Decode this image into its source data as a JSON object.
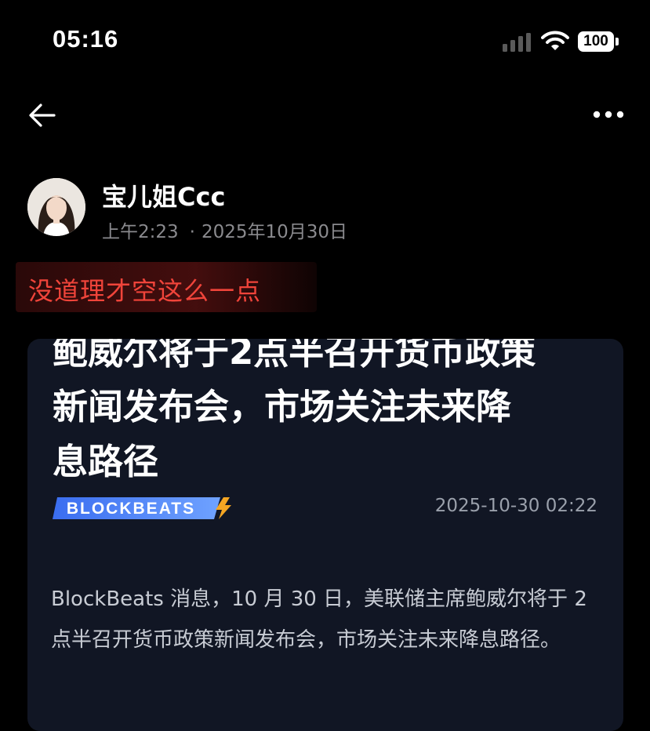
{
  "status_bar": {
    "time": "05:16",
    "battery": "100",
    "icons": [
      "signal-icon",
      "wifi-icon",
      "battery-icon"
    ]
  },
  "nav": {
    "icons": [
      "back-arrow-icon",
      "more-icon"
    ]
  },
  "post": {
    "author": "宝儿姐Ccc",
    "time": "上午2:23",
    "date": "2025年10月30日",
    "separator": "·",
    "text": "没道理才空这么一点"
  },
  "card": {
    "title_lines": [
      "鲍威尔将于2点半召开货币政策",
      "新闻发布会，市场关注未来降",
      "息路径"
    ],
    "source": "BLOCKBEATS",
    "datetime": "2025-10-30 02:22",
    "body": "BlockBeats 消息，10 月 30 日，美联储主席鲍威尔将于 2 点半召开货币政策新闻发布会，市场关注未来降息路径。",
    "colors": {
      "background": "#111624",
      "logo_gradient_start": "#3a6df0",
      "logo_gradient_end": "#6fa2ff",
      "bolt": "#f5a623"
    }
  },
  "colors": {
    "highlight_text": "#f0443a",
    "meta_gray": "#8a8a8e"
  }
}
